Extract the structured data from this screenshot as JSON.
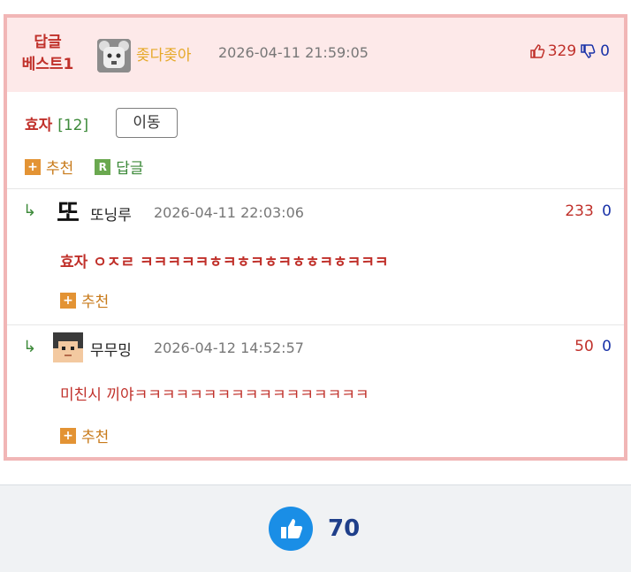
{
  "best": {
    "label_line1": "답글",
    "label_line2": "베스트1",
    "author": "좆다좆아",
    "date": "2026-04-11 21:59:05",
    "upvotes": "329",
    "downvotes": "0",
    "reply_to": "효자",
    "reply_count": "[12]",
    "move_label": "이동",
    "recommend_label": "추천",
    "reply_label": "답글"
  },
  "replies": [
    {
      "author": "또닝루",
      "avatar_text": "또",
      "date": "2026-04-11 22:03:06",
      "upvotes": "233",
      "downvotes": "0",
      "body": "효자 ㅇㅈㄹ ㅋㅋㅋㅋㅋㅎㅋㅎㅋㅎㅋㅎㅎㅋㅎㅋㅋㅋ",
      "recommend_label": "추천"
    },
    {
      "author": "무무밍",
      "date": "2026-04-12 14:52:57",
      "upvotes": "50",
      "downvotes": "0",
      "body": "미친시 끼야ㅋㅋㅋㅋㅋㅋㅋㅋㅋㅋㅋㅋㅋㅋㅋㅋㅋ",
      "recommend_label": "추천"
    }
  ],
  "footer": {
    "like_count": "70"
  },
  "colors": {
    "accent_red": "#c0302a",
    "accent_blue": "#1a33a8",
    "like_blue": "#1a8ee6",
    "best_bg": "#fde9e9",
    "best_border": "#f1b6b6"
  }
}
